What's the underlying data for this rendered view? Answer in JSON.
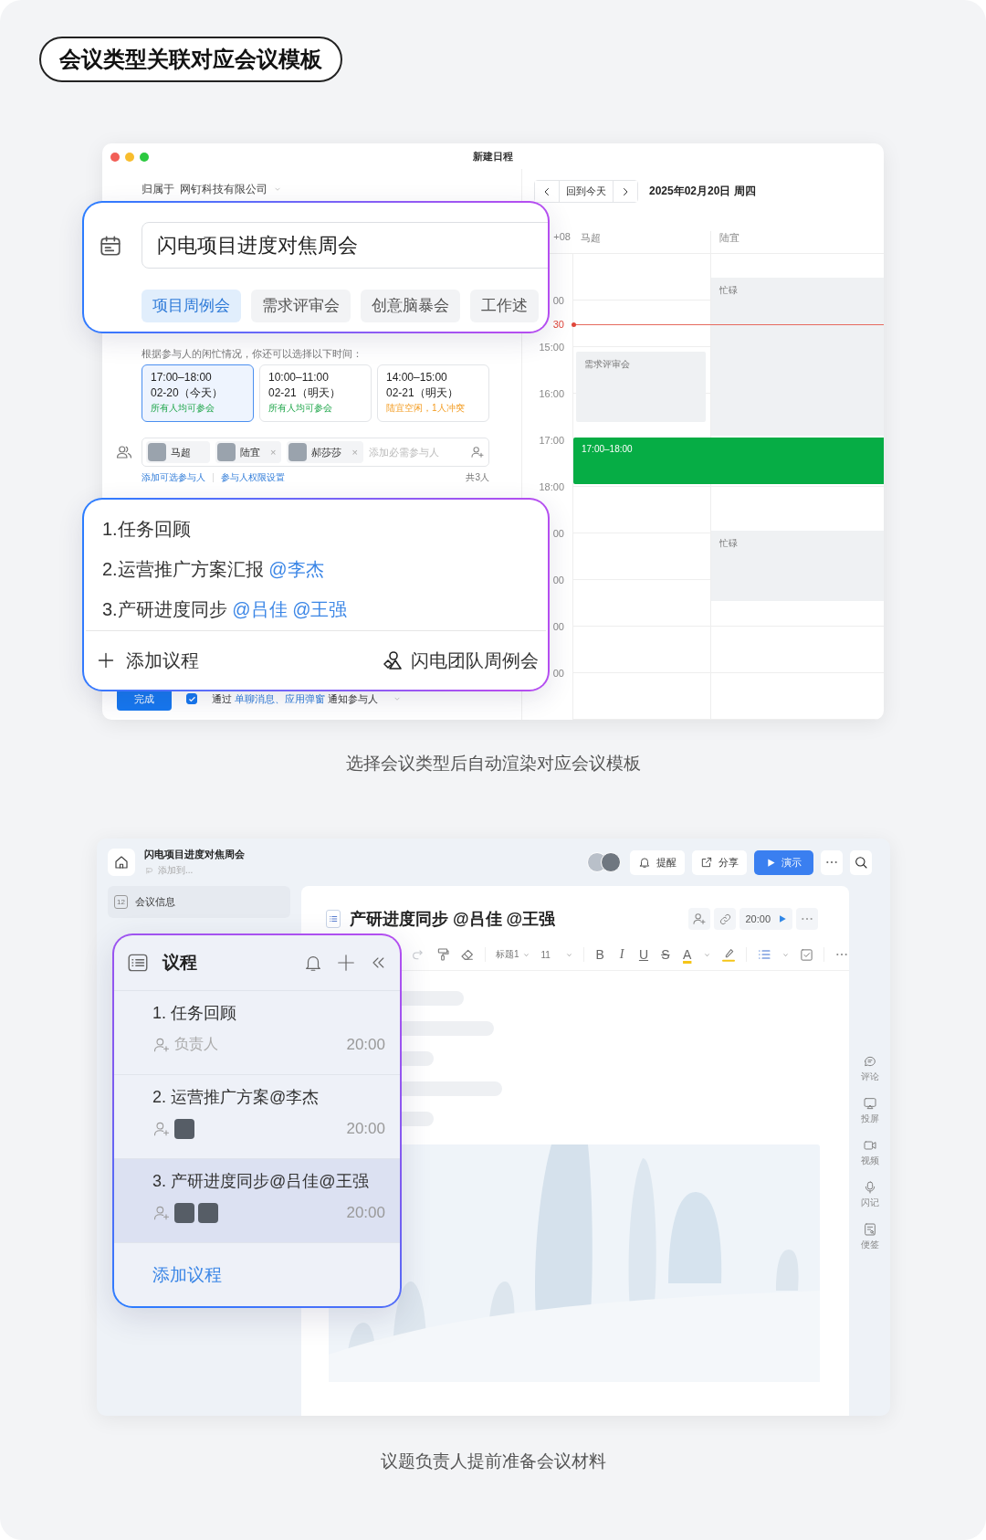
{
  "heading": "会议类型关联对应会议模板",
  "schedule_window": {
    "title": "新建日程",
    "owner": {
      "label": "归属于",
      "value": "网钉科技有限公司"
    },
    "type_picker": {
      "title_value": "闪电项目进度对焦周会",
      "types": [
        {
          "label": "项目周例会",
          "selected": true
        },
        {
          "label": "需求评审会",
          "selected": false
        },
        {
          "label": "创意脑暴会",
          "selected": false
        },
        {
          "label": "工作述",
          "selected": false
        }
      ]
    },
    "suggestion_hint": "根据参与人的闲忙情况，你还可以选择以下时间：",
    "time_options": [
      {
        "time": "17:00–18:00",
        "date": "02-20（今天）",
        "note": "所有人均可参会",
        "kind": "free",
        "selected": true
      },
      {
        "time": "10:00–11:00",
        "date": "02-21（明天）",
        "note": "所有人均可参会",
        "kind": "free",
        "selected": false
      },
      {
        "time": "14:00–15:00",
        "date": "02-21（明天）",
        "note": "陆宜空闲，1人冲突",
        "kind": "conflict",
        "selected": false
      }
    ],
    "attendees": [
      {
        "name": "马超"
      },
      {
        "name": "陆宜",
        "remove": "×"
      },
      {
        "name": "郝莎莎",
        "remove": "×"
      }
    ],
    "attendee_placeholder": "添加必需参与人",
    "links": [
      "添加可选参与人",
      "参与人权限设置"
    ],
    "attendee_count": "共3人",
    "agenda_template": {
      "items": [
        {
          "text": "1.任务回顾"
        },
        {
          "text": "2.运营推广方案汇报",
          "mentions": [
            "@李杰"
          ]
        },
        {
          "text": "3.产研进度同步",
          "mentions": [
            "@吕佳",
            "@王强"
          ]
        }
      ],
      "add_label": "添加议程",
      "template_name": "闪电团队周例会"
    },
    "done_button": "完成",
    "notify": {
      "checked": true,
      "prefix": "通过",
      "channels": "单聊消息、应用弹窗",
      "suffix": "通知参与人"
    },
    "calendar": {
      "today_button": "回到今天",
      "date": "2025年02月20日 周四",
      "timezone": "+08",
      "time_labels": [
        {
          "text": "00",
          "kind": "hour"
        },
        {
          "text": "30",
          "kind": "now"
        },
        {
          "text": "15:00",
          "kind": "hour"
        },
        {
          "text": "16:00",
          "kind": "hour"
        },
        {
          "text": "17:00",
          "kind": "hour"
        },
        {
          "text": "18:00",
          "kind": "hour"
        },
        {
          "text": "00",
          "kind": "hour"
        },
        {
          "text": "00",
          "kind": "hour"
        },
        {
          "text": "00",
          "kind": "hour"
        },
        {
          "text": "00",
          "kind": "hour"
        }
      ],
      "columns": [
        {
          "name": "马超",
          "events": [
            {
              "title": "需求评审会",
              "kind": "meeting"
            }
          ]
        },
        {
          "name": "陆宜",
          "events": [
            {
              "title": "忙碌",
              "kind": "busy"
            },
            {
              "title": "忙碌",
              "kind": "busy"
            }
          ]
        }
      ],
      "proposed_event": {
        "title": "17:00–18:00"
      }
    }
  },
  "caption_1": "选择会议类型后自动渲染对应会议模板",
  "doc_window": {
    "title": "闪电项目进度对焦周会",
    "subtitle": "添加到...",
    "actions": [
      {
        "label": "提醒",
        "kind": "remind"
      },
      {
        "label": "分享",
        "kind": "share"
      },
      {
        "label": "演示",
        "kind": "present"
      }
    ],
    "sidebar": [
      {
        "label": "会议信息",
        "icon_text": "12"
      }
    ],
    "doc": {
      "title": "产研进度同步 @吕佳 @王强",
      "time": "20:00",
      "toolbar": [
        {
          "kind": "redo"
        },
        {
          "kind": "painter"
        },
        {
          "kind": "eraser"
        },
        {
          "kind": "dropdown",
          "label": "标题1"
        },
        {
          "kind": "dropdown",
          "label": "11"
        },
        {
          "kind": "bold",
          "label": "B"
        },
        {
          "kind": "italic",
          "label": "I"
        },
        {
          "kind": "underline",
          "label": "U"
        },
        {
          "kind": "strike",
          "label": "S"
        },
        {
          "kind": "color",
          "label": "A"
        },
        {
          "kind": "highlight"
        },
        {
          "kind": "list"
        },
        {
          "kind": "todo"
        },
        {
          "kind": "more"
        }
      ]
    },
    "rail": [
      {
        "label": "评论",
        "kind": "comment"
      },
      {
        "label": "投屏",
        "kind": "cast"
      },
      {
        "label": "视频",
        "kind": "video"
      },
      {
        "label": "闪记",
        "kind": "mic"
      },
      {
        "label": "便签",
        "kind": "note"
      }
    ],
    "agenda_panel": {
      "title": "议程",
      "items": [
        {
          "title": "1. 任务回顾",
          "placeholder": "负责人",
          "time": "20:00",
          "selected": false
        },
        {
          "title": "2. 运营推广方案@李杰",
          "owners": [
            {
              "kind": "photo"
            }
          ],
          "time": "20:00",
          "selected": false
        },
        {
          "title": "3. 产研进度同步@吕佳@王强",
          "owners": [
            {
              "kind": "photo"
            },
            {
              "kind": "photo"
            }
          ],
          "time": "20:00",
          "selected": true
        }
      ],
      "add_label": "添加议程"
    }
  },
  "caption_2": "议题负责人提前准备会议材料"
}
